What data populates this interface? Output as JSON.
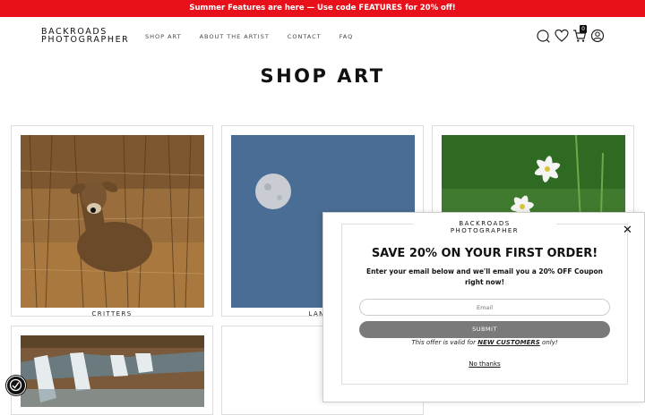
{
  "announcement": "Summer Features are here — Use code FEATURES for 20% off!",
  "logo": {
    "line1": "BACKROADS",
    "line2": "PHOTOGRAPHER"
  },
  "nav": [
    "SHOP ART",
    "ABOUT THE ARTIST",
    "CONTACT",
    "FAQ"
  ],
  "icons": {
    "search": "search-icon",
    "wishlist": "heart-icon",
    "cart": "cart-icon",
    "account": "account-icon"
  },
  "cart_count": "0",
  "page_title": "SHOP ART",
  "cards": [
    {
      "label": "CRITTERS"
    },
    {
      "label": "LANDS"
    },
    {
      "label": ""
    },
    {
      "label": ""
    },
    {
      "label": ""
    }
  ],
  "popup": {
    "brand_line1": "BACKROADS",
    "brand_line2": "PHOTOGRAPHER",
    "heading": "SAVE 20% ON YOUR FIRST ORDER!",
    "subtext": "Enter your email below and we'll email you a 20% OFF Coupon right now!",
    "email_placeholder": "Email",
    "submit_label": "SUBMIT",
    "offer_prefix": "This offer is valid for ",
    "offer_bold": "NEW CUSTOMERS",
    "offer_suffix": " only!",
    "no_thanks": "No thanks"
  },
  "colors": {
    "announce_bg": "#e8101a",
    "submit_bg": "#7a7a7a",
    "sky": "#4a6d95"
  }
}
